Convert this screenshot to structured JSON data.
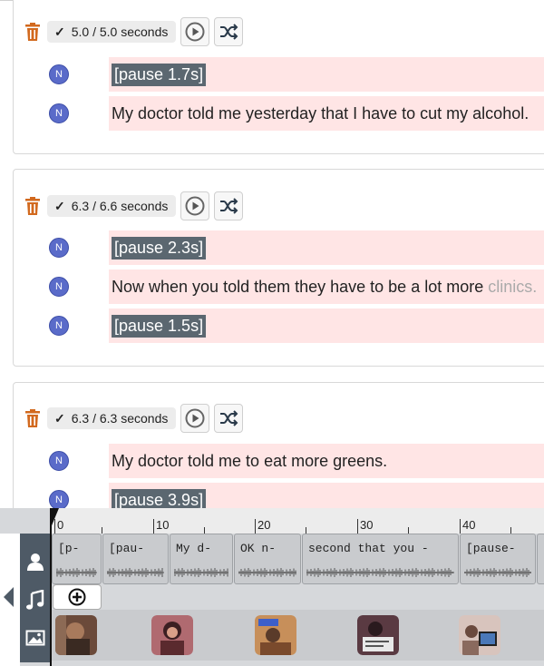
{
  "blocks": [
    {
      "duration": "5.0 / 5.0 seconds",
      "rows": [
        {
          "speaker": "N",
          "text": "[pause 1.7s]",
          "pause": true
        },
        {
          "speaker": "N",
          "text": "My doctor told me yesterday that I have to cut my alcohol.",
          "pause": false
        }
      ]
    },
    {
      "duration": "6.3 / 6.6 seconds",
      "rows": [
        {
          "speaker": "N",
          "text": "[pause 2.3s]",
          "pause": true
        },
        {
          "speaker": "N",
          "text": "Now when you told them they have to be a lot more",
          "extra": "clinics.",
          "pause": false
        },
        {
          "speaker": "N",
          "text": "[pause 1.5s]",
          "pause": true
        }
      ]
    },
    {
      "duration": "6.3 / 6.3 seconds",
      "rows": [
        {
          "speaker": "N",
          "text": "My doctor told me to eat more greens.",
          "pause": false
        },
        {
          "speaker": "N",
          "text": "[pause 3.9s]",
          "pause": true
        }
      ]
    }
  ],
  "icons": {
    "delete": "trash-icon",
    "play": "play-icon",
    "shuffle": "shuffle-icon",
    "speaker_lane": "person-icon",
    "music_lane": "music-note-icon",
    "image_lane": "image-icon",
    "add": "plus-circle-icon",
    "collapse": "triangle-left-icon"
  },
  "timeline": {
    "ruler_labels": [
      "0",
      "10",
      "20",
      "30",
      "40"
    ],
    "clips": [
      "[p-",
      "[pau-",
      "My d-",
      "OK n-",
      "second that you -",
      "[pause-"
    ]
  },
  "colors": {
    "segment_bg": "#ffe5e5",
    "pause_bg": "#5b6770",
    "avatar": "#5a6bc9",
    "trash": "#d2691e",
    "timeline_bg": "#d6d8db",
    "lane_icons_bg": "#4e5a66"
  }
}
